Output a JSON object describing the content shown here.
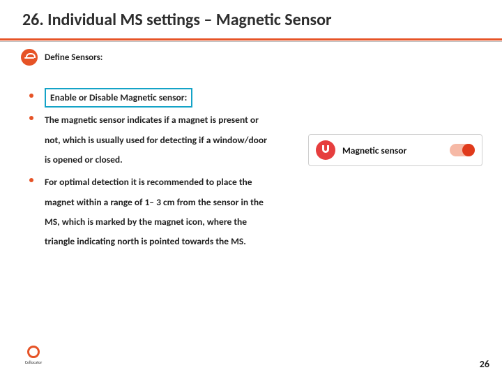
{
  "title": "26. Individual MS settings – Magnetic Sensor",
  "subhead": {
    "label": "Define Sensors:"
  },
  "bullets": [
    {
      "text": "Enable or Disable Magnetic sensor:",
      "boxed": true
    },
    {
      "text": "The magnetic sensor indicates if a magnet is present or not, which is usually used for detecting if a window/door is opened or closed.",
      "boxed": false
    },
    {
      "text": "For optimal detection it is recommended to place the magnet within a range of 1– 3 cm from the sensor in the MS, which is marked by the magnet icon, where the triangle indicating north is pointed towards the MS.",
      "boxed": false
    }
  ],
  "card": {
    "label": "Magnetic sensor",
    "toggle_state": "on"
  },
  "footer": {
    "brand": "Cellocator",
    "page_number": "26"
  },
  "colors": {
    "accent": "#e65326",
    "highlight_border": "#14a3c7"
  }
}
